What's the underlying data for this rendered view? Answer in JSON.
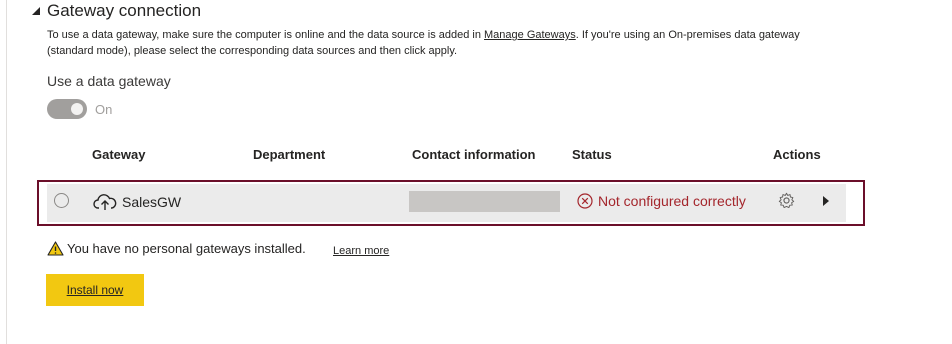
{
  "section": {
    "title": "Gateway connection",
    "description_before": "To use a data gateway, make sure the computer is online and the data source is added in ",
    "description_link": "Manage Gateways",
    "description_after": ". If you're using an On-premises data gateway (standard mode), please select the corresponding data sources and then click apply."
  },
  "toggle": {
    "label": "Use a data gateway",
    "state": "On"
  },
  "table": {
    "columns": [
      "Gateway",
      "Department",
      "Contact information",
      "Status",
      "Actions"
    ],
    "rows": [
      {
        "gateway": "SalesGW",
        "department": "",
        "status": "Not configured correctly"
      }
    ]
  },
  "warning": {
    "text": "You have no personal gateways installed.",
    "link": "Learn more"
  },
  "install_button": "Install now",
  "colors": {
    "accent_yellow": "#f2c811",
    "error_red": "#a4262c",
    "highlight_border": "#6b0f2a"
  }
}
